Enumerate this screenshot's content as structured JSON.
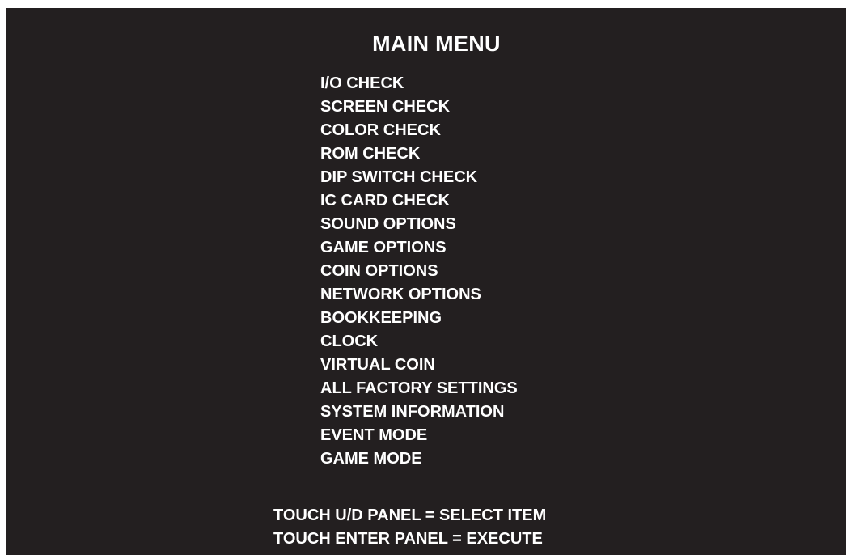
{
  "title": "MAIN MENU",
  "menu": {
    "items": [
      {
        "label": "I/O CHECK"
      },
      {
        "label": "SCREEN CHECK"
      },
      {
        "label": "COLOR CHECK"
      },
      {
        "label": "ROM CHECK"
      },
      {
        "label": "DIP SWITCH CHECK"
      },
      {
        "label": "IC CARD CHECK"
      },
      {
        "label": "SOUND OPTIONS"
      },
      {
        "label": "GAME OPTIONS"
      },
      {
        "label": "COIN OPTIONS"
      },
      {
        "label": "NETWORK OPTIONS"
      },
      {
        "label": "BOOKKEEPING"
      },
      {
        "label": "CLOCK"
      },
      {
        "label": "VIRTUAL COIN"
      },
      {
        "label": "ALL FACTORY SETTINGS"
      },
      {
        "label": "SYSTEM INFORMATION"
      },
      {
        "label": "EVENT MODE"
      },
      {
        "label": "GAME MODE"
      }
    ]
  },
  "instructions": {
    "select": "TOUCH U/D PANEL = SELECT ITEM",
    "execute": "TOUCH ENTER PANEL = EXECUTE"
  },
  "colors": {
    "background": "#231f20",
    "text": "#ffffff"
  }
}
